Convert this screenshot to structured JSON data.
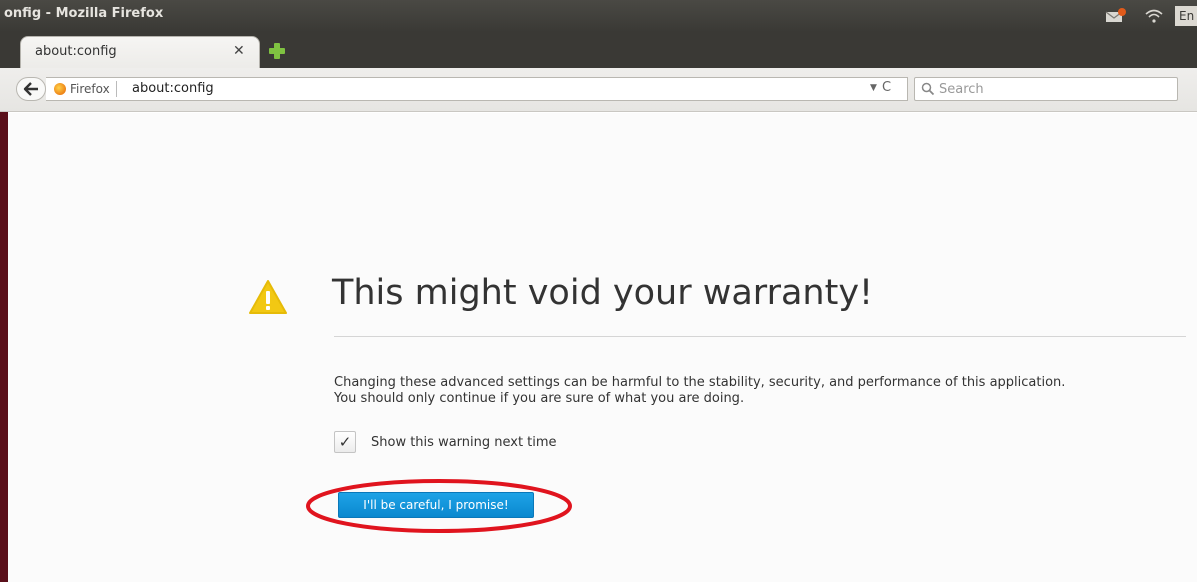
{
  "window": {
    "title": "onfig - Mozilla Firefox",
    "lang_indicator": "En"
  },
  "tabs": [
    {
      "label": "about:config",
      "active": true
    }
  ],
  "navbar": {
    "identity_label": "Firefox",
    "url": "about:config",
    "search_placeholder": "Search"
  },
  "warning": {
    "title": "This might void your warranty!",
    "body_line1": "Changing these advanced settings can be harmful to the stability, security, and performance of this application.",
    "body_line2": "You should only continue if you are sure of what you are doing.",
    "checkbox_label": "Show this warning next time",
    "checkbox_checked": true,
    "checkbox_glyph": "✓",
    "button_label": "I'll be careful, I promise!"
  },
  "colors": {
    "button_blue": "#0a88cf",
    "warning_yellow": "#f2c813",
    "highlight_red": "#e0141e",
    "title_bar": "#3a3935"
  },
  "icons": {
    "back": "back-arrow-icon",
    "identity": "firefox-icon",
    "reload": "reload-icon",
    "search": "search-icon",
    "warning": "warning-triangle-icon",
    "new_tab": "plus-icon",
    "close": "close-icon"
  }
}
